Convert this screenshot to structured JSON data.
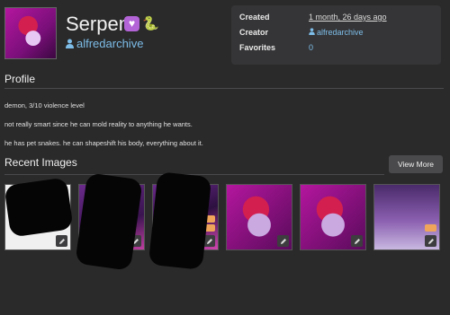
{
  "character": {
    "name": "Serpent",
    "badges": [
      "purple-heart-icon",
      "snake-icon"
    ],
    "creator": "alfredarchive"
  },
  "info": {
    "created_label": "Created",
    "created_value": "1 month, 26 days ago",
    "creator_label": "Creator",
    "creator_value": "alfredarchive",
    "favorites_label": "Favorites",
    "favorites_value": "0"
  },
  "profile": {
    "title": "Profile",
    "lines": [
      "demon, 3/10 violence level",
      "not really smart since he can mold reality to anything he wants.",
      "he has pet snakes. he can shapeshift his body, everything about it."
    ]
  },
  "recent": {
    "title": "Recent Images",
    "view_more_label": "View More",
    "thumbnail_count": 6
  },
  "colors": {
    "background": "#2a2a2b",
    "panel": "#353537",
    "link": "#7dbde8",
    "accent_heart": "#b364d6",
    "tag": "#f0a65a"
  }
}
